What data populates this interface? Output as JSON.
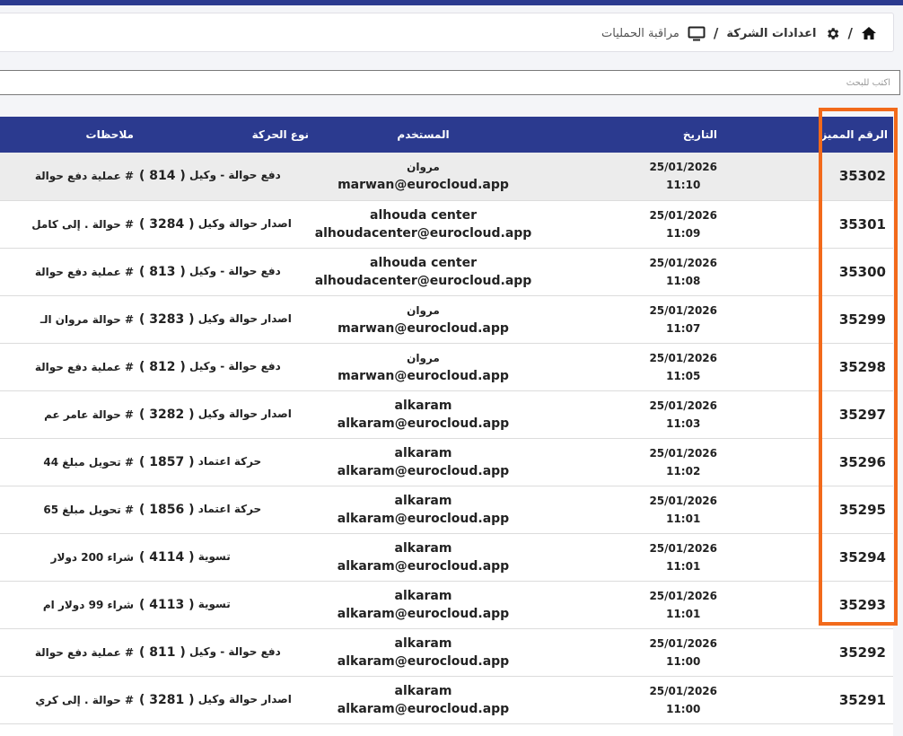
{
  "breadcrumb": {
    "home_icon": "home-icon",
    "settings_icon": "gear-icon",
    "settings_label": "اعدادات الشركة",
    "separator": "/",
    "monitor_icon": "monitor-icon",
    "page_label": "مراقبة الحمليات"
  },
  "search": {
    "placeholder": "اكتب للبحث",
    "value": ""
  },
  "table": {
    "headers": {
      "id": "الرقم المميز",
      "date": "التاريخ",
      "user": "المستخدم",
      "type": "نوع الحركة",
      "notes": "ملاحظات"
    },
    "rows": [
      {
        "id": "35302",
        "date": "25/01/2026",
        "time": "11:10",
        "user_name": "مروان",
        "user_email": "marwan@eurocloud.app",
        "type_text": "دفع حوالة - وكيل",
        "type_num": "( 814 )",
        "notes": "# عملية دفع حوالة"
      },
      {
        "id": "35301",
        "date": "25/01/2026",
        "time": "11:09",
        "user_name": "alhouda center",
        "user_email": "alhoudacenter@eurocloud.app",
        "type_text": "اصدار حوالة وكيل",
        "type_num": "( 3284 )",
        "notes": "# حوالة . إلى كامل"
      },
      {
        "id": "35300",
        "date": "25/01/2026",
        "time": "11:08",
        "user_name": "alhouda center",
        "user_email": "alhoudacenter@eurocloud.app",
        "type_text": "دفع حوالة - وكيل",
        "type_num": "( 813 )",
        "notes": "# عملية دفع حوالة"
      },
      {
        "id": "35299",
        "date": "25/01/2026",
        "time": "11:07",
        "user_name": "مروان",
        "user_email": "marwan@eurocloud.app",
        "type_text": "اصدار حوالة وكيل",
        "type_num": "( 3283 )",
        "notes": "# حوالة مروان الـ"
      },
      {
        "id": "35298",
        "date": "25/01/2026",
        "time": "11:05",
        "user_name": "مروان",
        "user_email": "marwan@eurocloud.app",
        "type_text": "دفع حوالة - وكيل",
        "type_num": "( 812 )",
        "notes": "# عملية دفع حوالة"
      },
      {
        "id": "35297",
        "date": "25/01/2026",
        "time": "11:03",
        "user_name": "alkaram",
        "user_email": "alkaram@eurocloud.app",
        "type_text": "اصدار حوالة وكيل",
        "type_num": "( 3282 )",
        "notes": "# حوالة عامر عم"
      },
      {
        "id": "35296",
        "date": "25/01/2026",
        "time": "11:02",
        "user_name": "alkaram",
        "user_email": "alkaram@eurocloud.app",
        "type_text": "حركة اعتماد",
        "type_num": "( 1857 )",
        "notes": "# تحويل مبلغ 44"
      },
      {
        "id": "35295",
        "date": "25/01/2026",
        "time": "11:01",
        "user_name": "alkaram",
        "user_email": "alkaram@eurocloud.app",
        "type_text": "حركة اعتماد",
        "type_num": "( 1856 )",
        "notes": "# تحويل مبلغ 65"
      },
      {
        "id": "35294",
        "date": "25/01/2026",
        "time": "11:01",
        "user_name": "alkaram",
        "user_email": "alkaram@eurocloud.app",
        "type_text": "تسوية",
        "type_num": "( 4114 )",
        "notes": "شراء 200 دولار"
      },
      {
        "id": "35293",
        "date": "25/01/2026",
        "time": "11:01",
        "user_name": "alkaram",
        "user_email": "alkaram@eurocloud.app",
        "type_text": "تسوية",
        "type_num": "( 4113 )",
        "notes": "شراء 99 دولار ام"
      },
      {
        "id": "35292",
        "date": "25/01/2026",
        "time": "11:00",
        "user_name": "alkaram",
        "user_email": "alkaram@eurocloud.app",
        "type_text": "دفع حوالة - وكيل",
        "type_num": "( 811 )",
        "notes": "# عملية دفع حوالة"
      },
      {
        "id": "35291",
        "date": "25/01/2026",
        "time": "11:00",
        "user_name": "alkaram",
        "user_email": "alkaram@eurocloud.app",
        "type_text": "اصدار حوالة وكيل",
        "type_num": "( 3281 )",
        "notes": "# حوالة . إلى كري"
      }
    ]
  },
  "colors": {
    "header_bg": "#2b3a8f",
    "highlight_border": "#f26a1b",
    "row_highlight": "#ececec"
  }
}
